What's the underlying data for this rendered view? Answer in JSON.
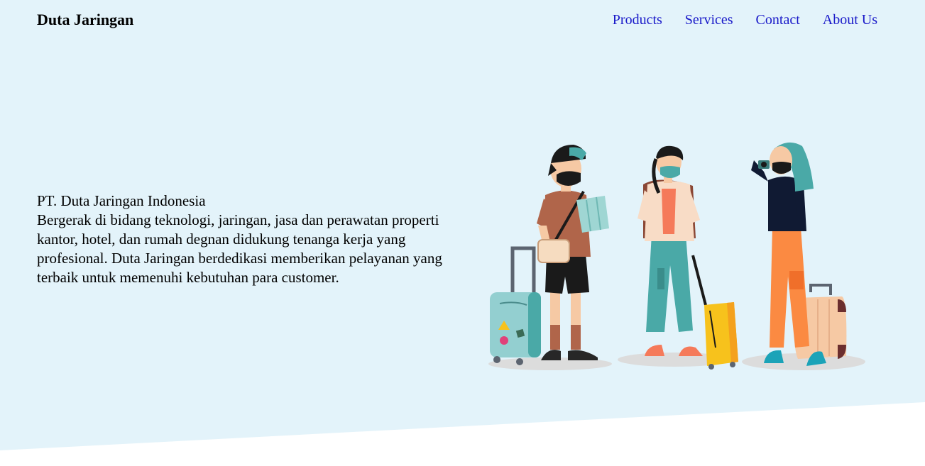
{
  "header": {
    "brand": "Duta Jaringan",
    "nav": [
      {
        "label": "Products"
      },
      {
        "label": "Services"
      },
      {
        "label": "Contact"
      },
      {
        "label": "About Us"
      }
    ]
  },
  "hero": {
    "company": "PT. Duta Jaringan Indonesia",
    "description": "Bergerak di bidang teknologi, jaringan, jasa dan perawatan properti kantor, hotel, dan rumah degnan didukung tenanga kerja yang profesional. Duta Jaringan berdedikasi memberikan pelayanan yang terbaik untuk memenuhi kebutuhan para customer.",
    "illustration": "travelers-illustration"
  },
  "colors": {
    "hero_background": "#e3f3fa",
    "nav_link": "#1a1ac9",
    "teal": "#4aa9a7",
    "orange": "#fb8a42",
    "yellow": "#f7c21c",
    "rust": "#b0654a"
  }
}
